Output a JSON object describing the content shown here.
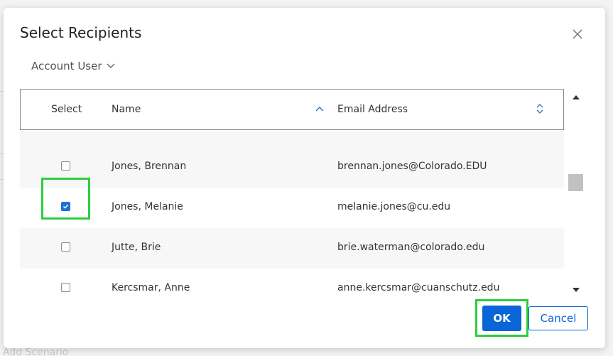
{
  "dialog": {
    "title": "Select Recipients",
    "filter_label": "Account User",
    "ok_label": "OK",
    "cancel_label": "Cancel"
  },
  "table": {
    "headers": {
      "select": "Select",
      "name": "Name",
      "email": "Email Address"
    },
    "rows": [
      {
        "name": "Jones, Brennan",
        "email": "brennan.jones@Colorado.EDU",
        "checked": false
      },
      {
        "name": "Jones, Melanie",
        "email": "melanie.jones@cu.edu",
        "checked": true
      },
      {
        "name": "Jutte, Brie",
        "email": "brie.waterman@colorado.edu",
        "checked": false
      },
      {
        "name": "Kercsmar, Anne",
        "email": "anne.kercsmar@cuanschutz.edu",
        "checked": false
      }
    ]
  },
  "background": {
    "add_scenario": "Add Scenario"
  },
  "colors": {
    "accent": "#0a66d6",
    "highlight": "#2ecc40"
  },
  "icons": {
    "close": "close-icon",
    "filter_chevron": "chevron-down-icon",
    "name_sort": "sort-ascending-icon",
    "email_sort": "sort-both-icon",
    "checkbox_check": "checkmark-icon"
  }
}
